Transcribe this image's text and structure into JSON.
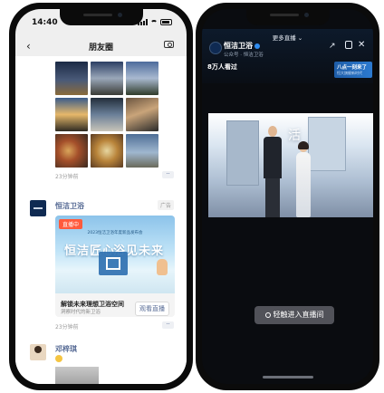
{
  "left": {
    "status": {
      "time": "14:40"
    },
    "header": {
      "title": "朋友圈"
    },
    "post1": {
      "time": "23分钟前"
    },
    "ad": {
      "name": "恒洁卫浴",
      "badge": "广告",
      "live_tag": "直播中",
      "banner_small": "2023恒洁卫浴年度新品发布会",
      "banner_big_left": "恒洁匠心",
      "banner_big_right": "浴见未来",
      "caption": "解锁未来理想卫浴空间",
      "subcaption": "洞察时代的新卫浴",
      "button": "观看直播",
      "time": "23分钟前"
    },
    "post2": {
      "name": "邓梓琪"
    }
  },
  "right": {
    "more_live": "更多直播",
    "account": {
      "name": "恒洁卫浴",
      "sub": "公众号 · 恒洁卫浴"
    },
    "viewers": "8万人看过",
    "promo": {
      "title": "八点一刻来了",
      "sub": "恒大旗舰新时代"
    },
    "stage_text": "活",
    "enter_button": "轻触进入直播间"
  }
}
